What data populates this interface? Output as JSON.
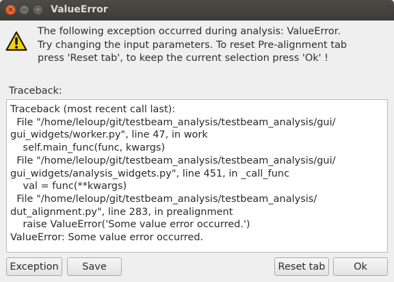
{
  "window": {
    "title": "ValueError",
    "close_glyph": "×",
    "minimize_glyph": "−",
    "maximize_glyph": "□"
  },
  "icon": {
    "name": "warning-icon",
    "color": "#f5d20a"
  },
  "message": {
    "lines": [
      "The following exception occurred during analysis: ValueError.",
      "Try changing the input parameters. To reset Pre-alignment tab",
      "press 'Reset tab', to keep the current selection press 'Ok' !"
    ]
  },
  "traceback": {
    "label": "Traceback:",
    "lines": [
      "Traceback (most recent call last):",
      "  File \"/home/leloup/git/testbeam_analysis/testbeam_analysis/gui/",
      "gui_widgets/worker.py\", line 47, in work",
      "    self.main_func(func, kwargs)",
      "  File \"/home/leloup/git/testbeam_analysis/testbeam_analysis/gui/",
      "gui_widgets/analysis_widgets.py\", line 451, in _call_func",
      "    val = func(**kwargs)",
      "  File \"/home/leloup/git/testbeam_analysis/testbeam_analysis/",
      "dut_alignment.py\", line 283, in prealignment",
      "    raise ValueError('Some value error occurred.')",
      "ValueError: Some value error occurred."
    ]
  },
  "buttons": {
    "exception": "Exception",
    "save": "Save",
    "reset": "Reset tab",
    "ok": "Ok"
  }
}
